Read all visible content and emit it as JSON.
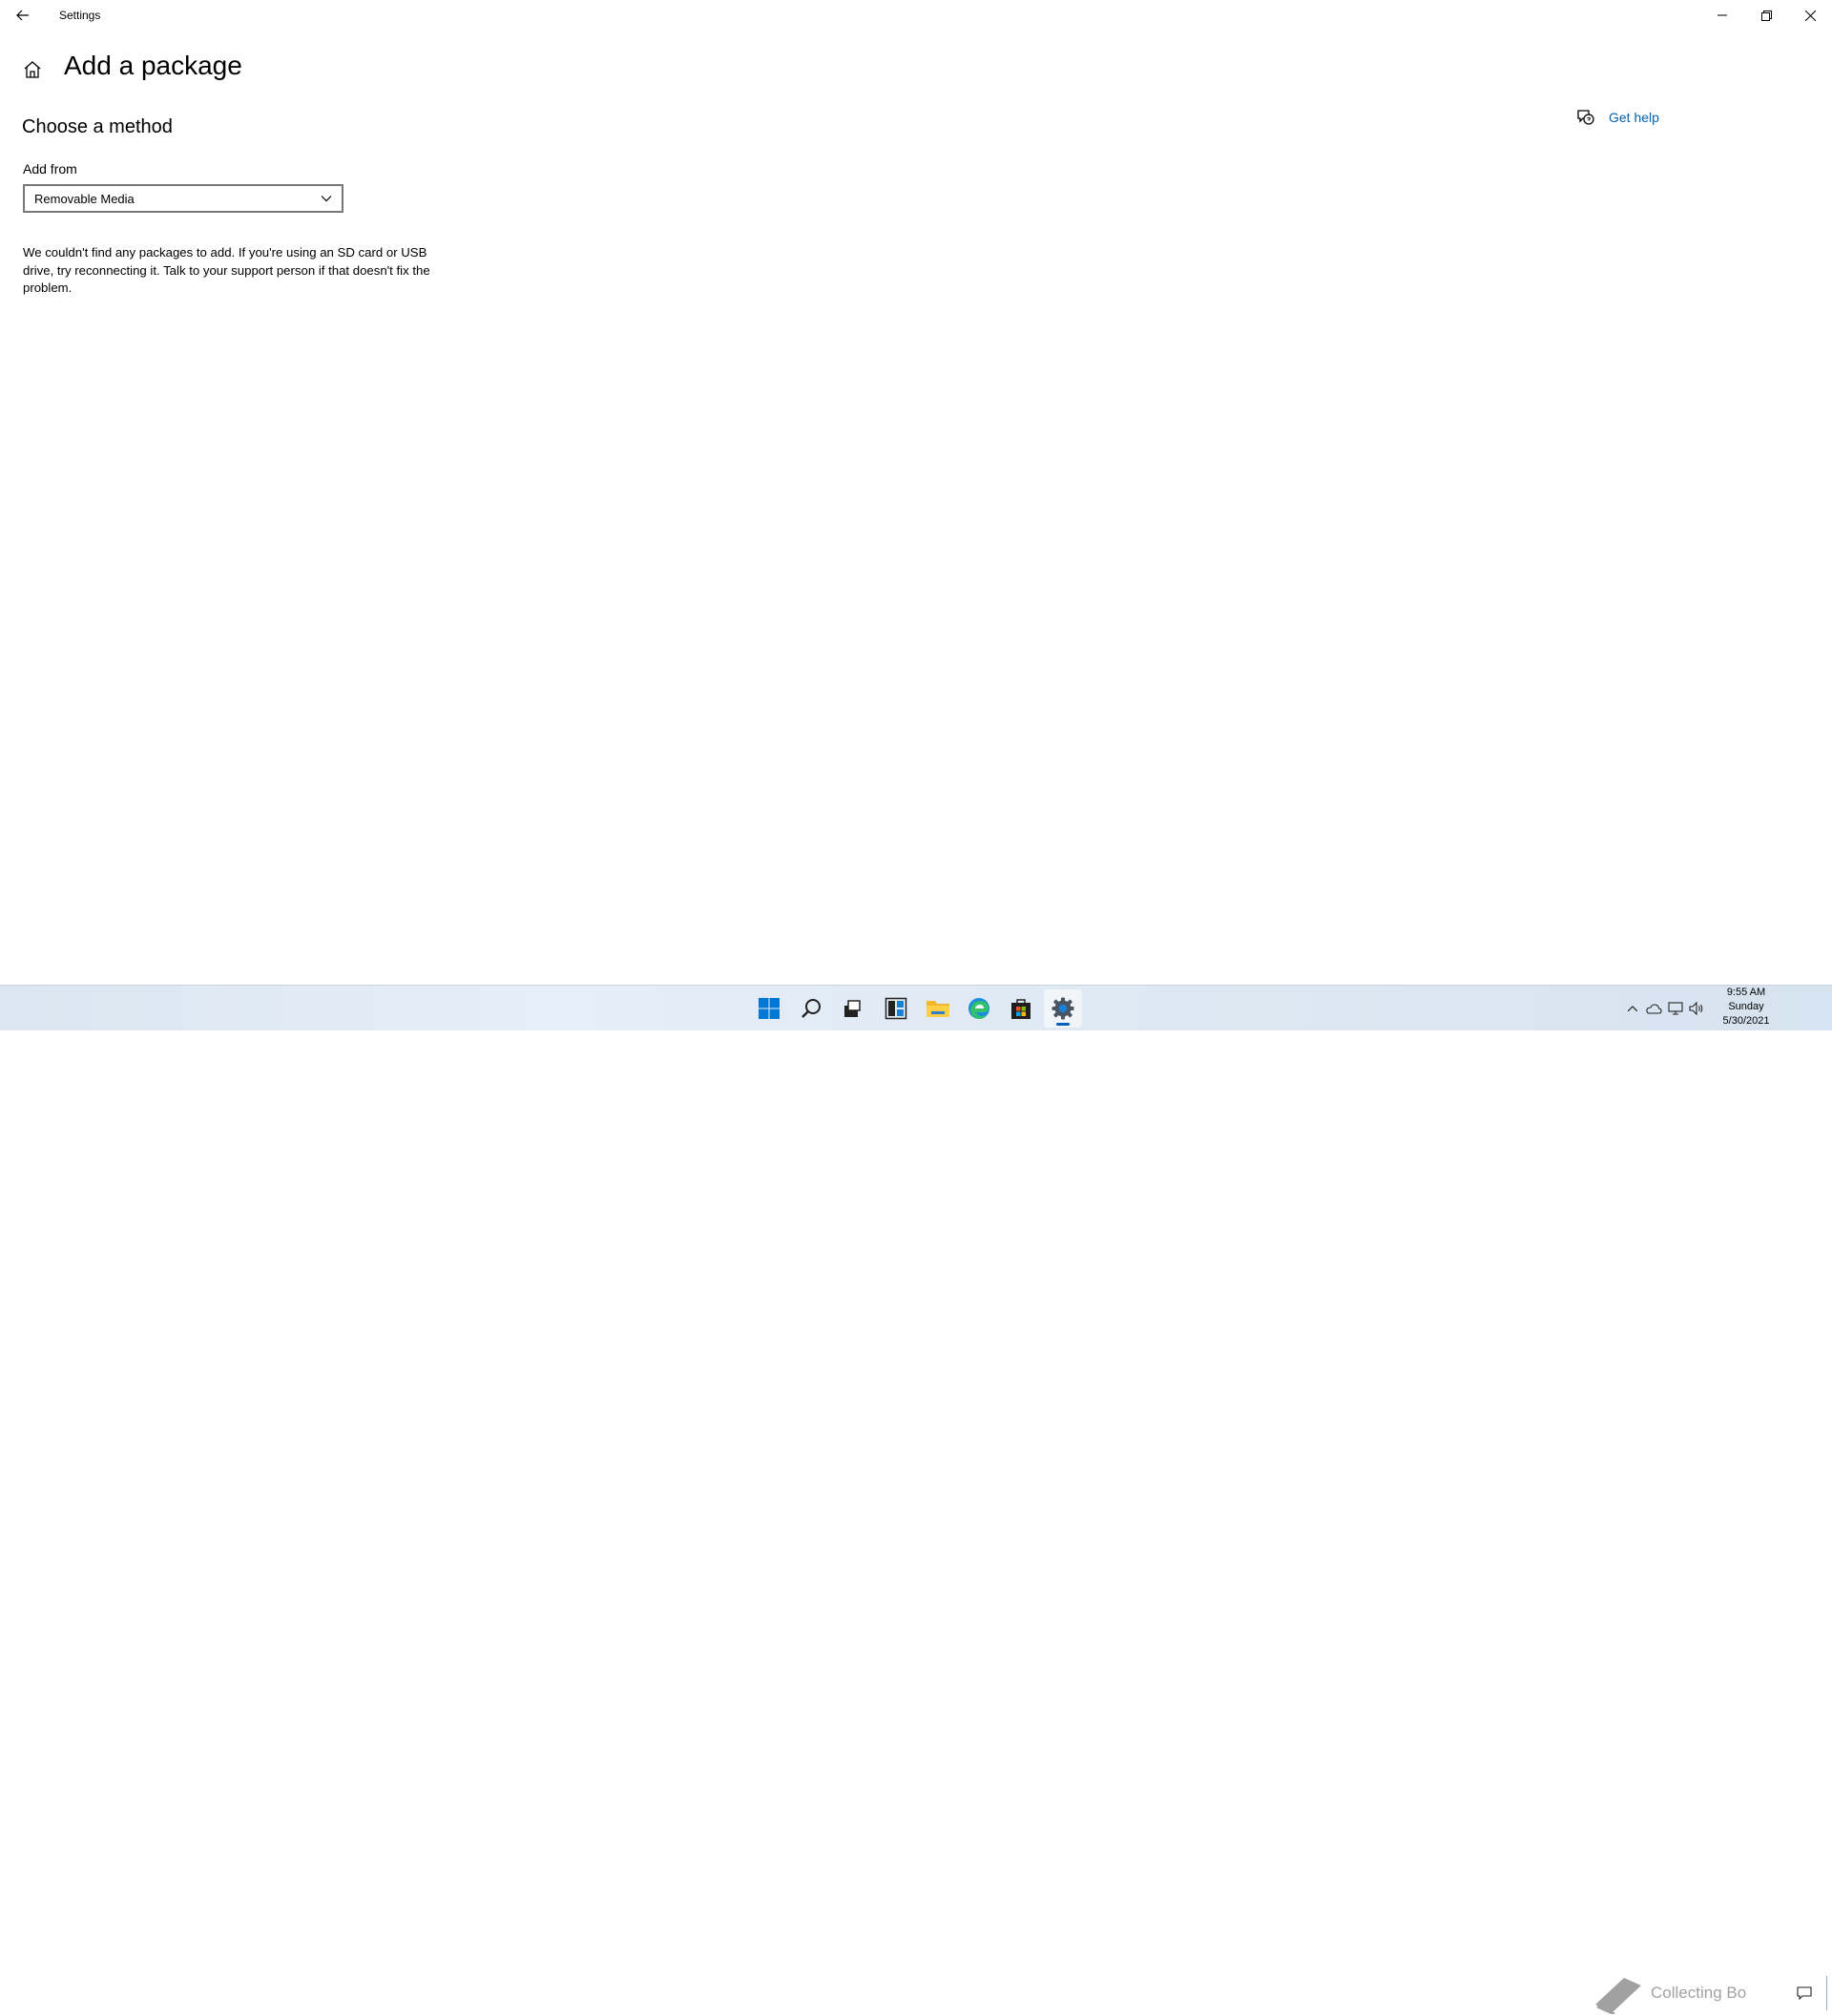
{
  "window": {
    "title": "Settings",
    "controls": {
      "minimize": "minimize-icon",
      "restore": "restore-icon",
      "close": "close-icon"
    }
  },
  "page": {
    "title": "Add a package",
    "section_title": "Choose a method",
    "get_help_label": "Get help",
    "add_from_label": "Add from",
    "add_from_value": "Removable Media",
    "message": "We couldn't find any packages to add. If you're using an SD card or USB drive, try reconnecting it. Talk to your support person if that doesn't fix the problem."
  },
  "taskbar": {
    "apps": [
      {
        "name": "start",
        "icon": "windows-logo-icon",
        "active": false
      },
      {
        "name": "search",
        "icon": "search-icon",
        "active": false
      },
      {
        "name": "task-view",
        "icon": "task-view-icon",
        "active": false
      },
      {
        "name": "widgets",
        "icon": "widgets-icon",
        "active": false
      },
      {
        "name": "file-explorer",
        "icon": "folder-icon",
        "active": false
      },
      {
        "name": "edge",
        "icon": "edge-icon",
        "active": false
      },
      {
        "name": "store",
        "icon": "store-icon",
        "active": false
      },
      {
        "name": "settings",
        "icon": "gear-icon",
        "active": true
      }
    ],
    "clock": {
      "time": "9:55 AM",
      "day": "Sunday",
      "date": "5/30/2021"
    },
    "watermark_text": "Collecting Bo"
  },
  "colors": {
    "accent": "#0063b1",
    "taskbar": "#dfe9f4",
    "start_blue": "#0078d4"
  }
}
